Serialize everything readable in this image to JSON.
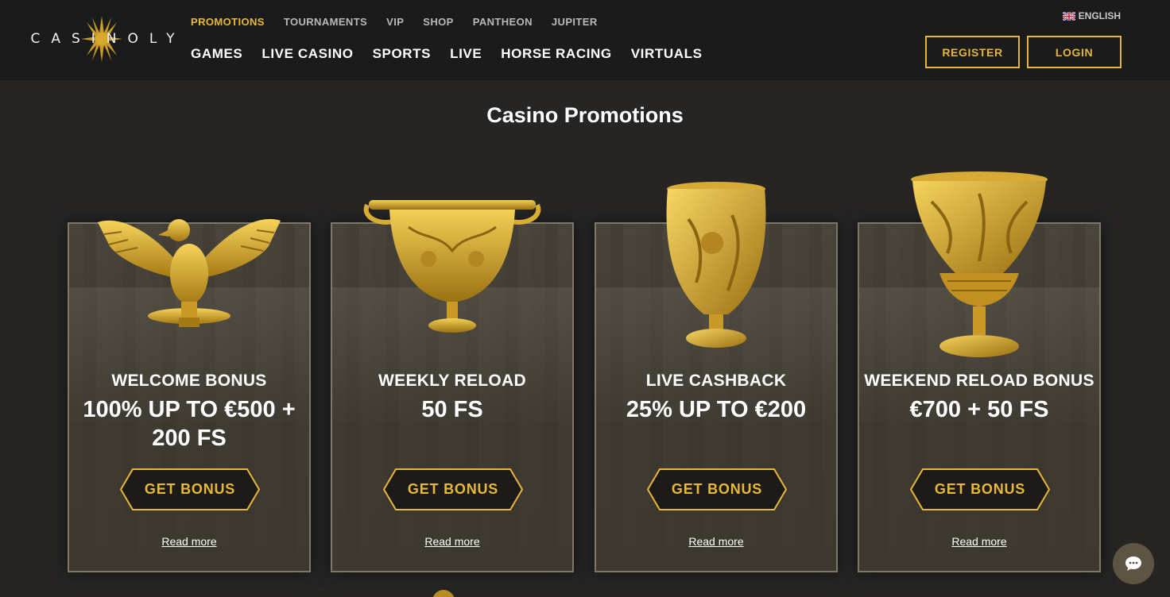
{
  "brand": {
    "name": "CASINOLY"
  },
  "header": {
    "top_nav": [
      "PROMOTIONS",
      "TOURNAMENTS",
      "VIP",
      "SHOP",
      "PANTHEON",
      "JUPITER"
    ],
    "main_nav": [
      "GAMES",
      "LIVE CASINO",
      "SPORTS",
      "LIVE",
      "HORSE RACING",
      "VIRTUALS"
    ],
    "language": "ENGLISH",
    "register_label": "REGISTER",
    "login_label": "LOGIN"
  },
  "page": {
    "title": "Casino Promotions"
  },
  "promotions": [
    {
      "label": "WELCOME BONUS",
      "offer": "100% UP TO €500 + 200 FS",
      "button": "GET BONUS",
      "link": "Read more",
      "image": "golden-eagle"
    },
    {
      "label": "WEEKLY RELOAD",
      "offer": "50 FS",
      "button": "GET BONUS",
      "link": "Read more",
      "image": "golden-cup-handles"
    },
    {
      "label": "LIVE CASHBACK",
      "offer": "25% UP TO €200",
      "button": "GET BONUS",
      "link": "Read more",
      "image": "golden-goblet"
    },
    {
      "label": "WEEKEND RELOAD BONUS",
      "offer": "€700 + 50 FS",
      "button": "GET BONUS",
      "link": "Read more",
      "image": "golden-krater"
    }
  ],
  "icons": {
    "chat": "chat-bubble-icon",
    "flag": "uk-flag-icon",
    "logo_sun": "sun-icon"
  },
  "colors": {
    "accent": "#e8b83a",
    "background": "#262524",
    "header": "#1b1b1b"
  }
}
